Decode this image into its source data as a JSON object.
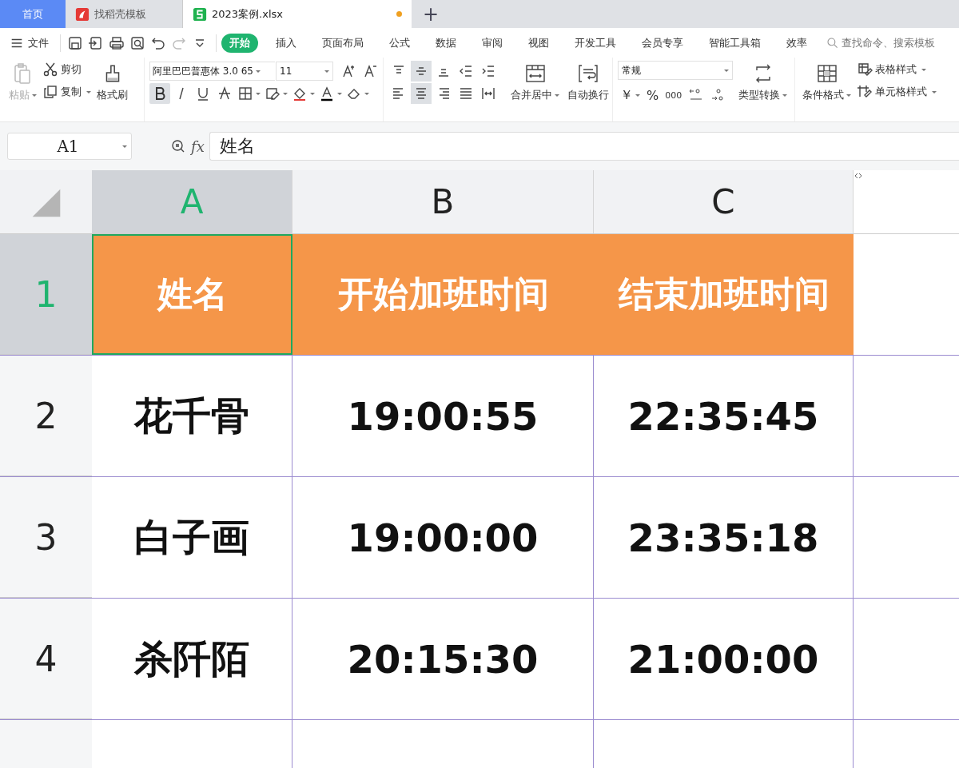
{
  "doc_tabs": [
    {
      "kind": "home",
      "label": "首页",
      "selected": false
    },
    {
      "kind": "template",
      "label": "找稻壳模板",
      "selected": false
    },
    {
      "kind": "sheet",
      "label": "2023案例.xlsx",
      "selected": true,
      "unsaved": true
    }
  ],
  "new_tab": "+",
  "file_menu": "文件",
  "menu_tabs": [
    {
      "label": "开始",
      "selected": true
    },
    {
      "label": "插入",
      "selected": false
    },
    {
      "label": "页面布局",
      "selected": false
    },
    {
      "label": "公式",
      "selected": false
    },
    {
      "label": "数据",
      "selected": false
    },
    {
      "label": "审阅",
      "selected": false
    },
    {
      "label": "视图",
      "selected": false
    },
    {
      "label": "开发工具",
      "selected": false
    },
    {
      "label": "会员专享",
      "selected": false
    },
    {
      "label": "智能工具箱",
      "selected": false
    },
    {
      "label": "效率",
      "selected": false
    }
  ],
  "search": {
    "placeholder": "查找命令、搜索模板"
  },
  "ribbon": {
    "paste": {
      "label": "粘贴",
      "disabled": true
    },
    "cut": "剪切",
    "copy": "复制",
    "format_painter": "格式刷",
    "font_name": "阿里巴巴普惠体 3.0 65",
    "font_size": "11",
    "font_buttons": [
      {
        "kind": "bold",
        "selected": true
      },
      {
        "kind": "italic",
        "selected": false
      },
      {
        "kind": "underline",
        "selected": false
      },
      {
        "kind": "strike",
        "selected": false
      },
      {
        "kind": "border",
        "selected": false
      },
      {
        "kind": "fill-pattern",
        "selected": false
      },
      {
        "kind": "fill-color",
        "selected": false
      },
      {
        "kind": "font-color",
        "selected": false
      },
      {
        "kind": "eraser",
        "selected": false
      }
    ],
    "align_buttons": [
      {
        "kind": "top",
        "selected": false
      },
      {
        "kind": "middle",
        "selected": true
      },
      {
        "kind": "bottom",
        "selected": false
      },
      {
        "kind": "outdent",
        "selected": false
      },
      {
        "kind": "indent",
        "selected": false
      },
      {
        "kind": "left",
        "selected": false
      },
      {
        "kind": "center",
        "selected": true
      },
      {
        "kind": "right",
        "selected": false
      },
      {
        "kind": "justify",
        "selected": false
      },
      {
        "kind": "distribute",
        "selected": false
      }
    ],
    "merge": "合并居中",
    "wrap": "自动换行",
    "number_format": "常规",
    "currency": "￥",
    "percent": "%",
    "thousands": "000",
    "type_convert": "类型转换",
    "conditional_format": "条件格式",
    "table_style": "表格样式",
    "cell_style": "单元格样式"
  },
  "name_box": "A1",
  "formula_label": "fx",
  "formula": "姓名",
  "columns": [
    {
      "label": "A",
      "selected": true
    },
    {
      "label": "B",
      "selected": false
    },
    {
      "label": "C",
      "selected": false
    }
  ],
  "rows": [
    {
      "number": "1",
      "selected": true,
      "kind": "header",
      "cells": [
        "姓名",
        "开始加班时间",
        "结束加班时间"
      ]
    },
    {
      "number": "2",
      "selected": false,
      "kind": "data",
      "cells": [
        "花千骨",
        "19:00:55",
        "22:35:45"
      ]
    },
    {
      "number": "3",
      "selected": false,
      "kind": "data",
      "cells": [
        "白子画",
        "19:00:00",
        "23:35:18"
      ]
    },
    {
      "number": "4",
      "selected": false,
      "kind": "data",
      "cells": [
        "杀阡陌",
        "20:15:30",
        "21:00:00"
      ]
    }
  ]
}
